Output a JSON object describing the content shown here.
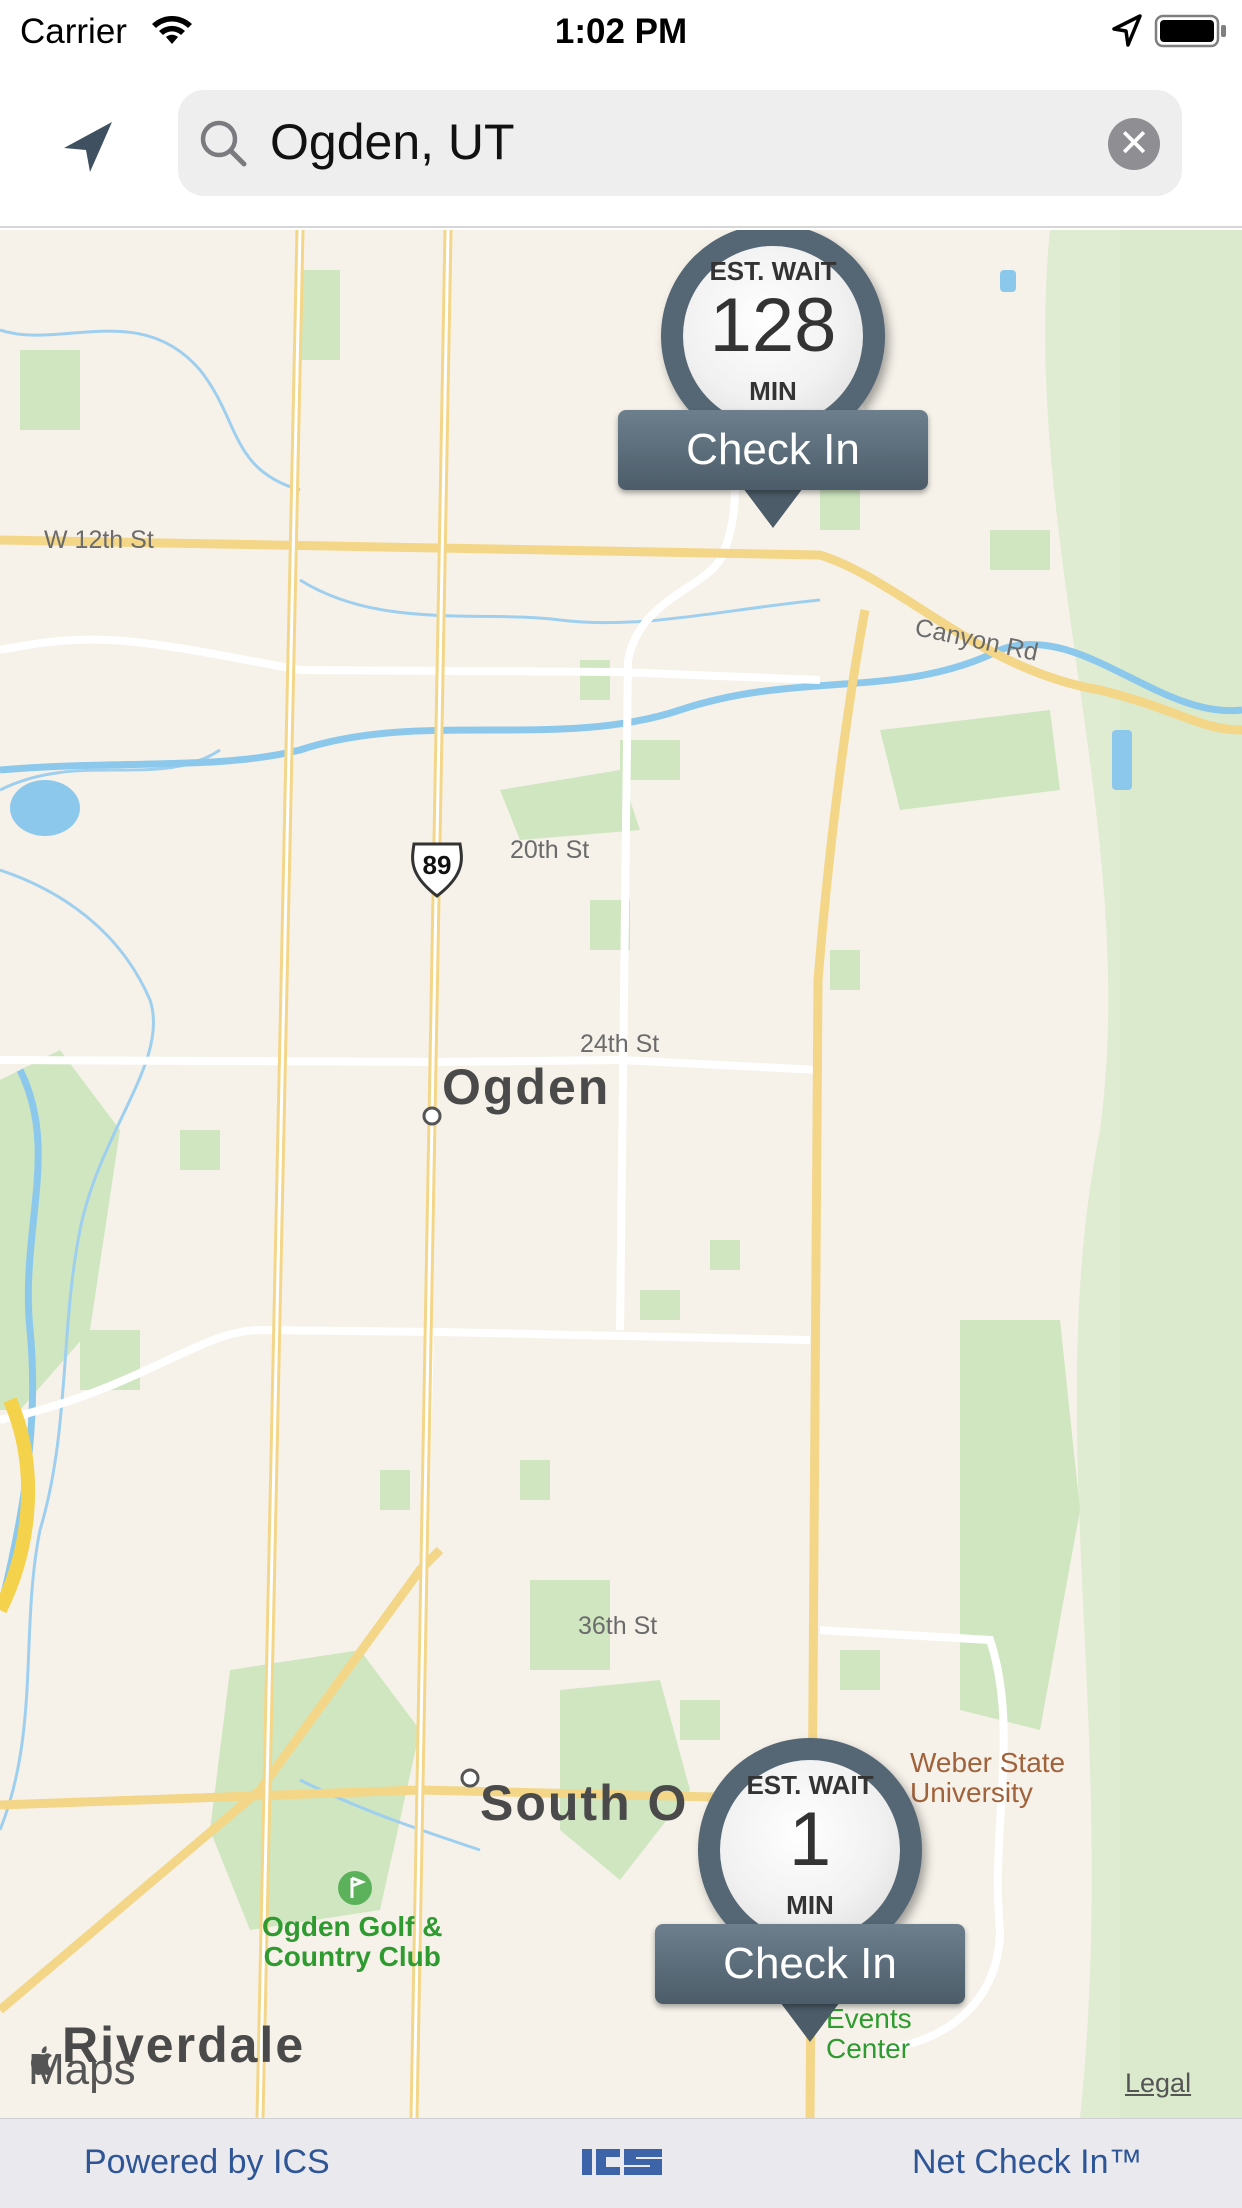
{
  "status_bar": {
    "carrier": "Carrier",
    "time": "1:02 PM"
  },
  "search": {
    "value": "Ogden, UT",
    "clear_symbol": "✕"
  },
  "map": {
    "streets": {
      "w12th": "W 12th St",
      "canyon": "Canyon Rd",
      "s20th": "20th St",
      "s24th": "24th St",
      "s36th": "36th St"
    },
    "highway_shield": "89",
    "cities": {
      "ogden": "Ogden",
      "south_ogden": "South O",
      "riverdale": "Riverdale"
    },
    "poi": {
      "golf": "Ogden Golf &\nCountry Club",
      "weber": "Weber State\nUniversity",
      "events": "Events\nCenter"
    },
    "attribution": "Maps",
    "legal": "Legal"
  },
  "pins": [
    {
      "label": "EST. WAIT",
      "value": "128",
      "unit": "MIN",
      "button": "Check In"
    },
    {
      "label": "EST. WAIT",
      "value": "1",
      "unit": "MIN",
      "button": "Check In"
    }
  ],
  "footer": {
    "left": "Powered by ICS",
    "right": "Net Check In™"
  },
  "colors": {
    "map_background": "#f6f2ea",
    "park_green": "#cfe6c0",
    "road_yellow": "#f5d98a",
    "water_blue": "#8cc8ec",
    "pin_slate": "#556674",
    "footer_text": "#2e5596"
  },
  "icons": [
    "wifi-icon",
    "location-arrow-icon",
    "battery-icon",
    "navigation-icon",
    "search-icon",
    "clear-icon",
    "ics-logo"
  ]
}
